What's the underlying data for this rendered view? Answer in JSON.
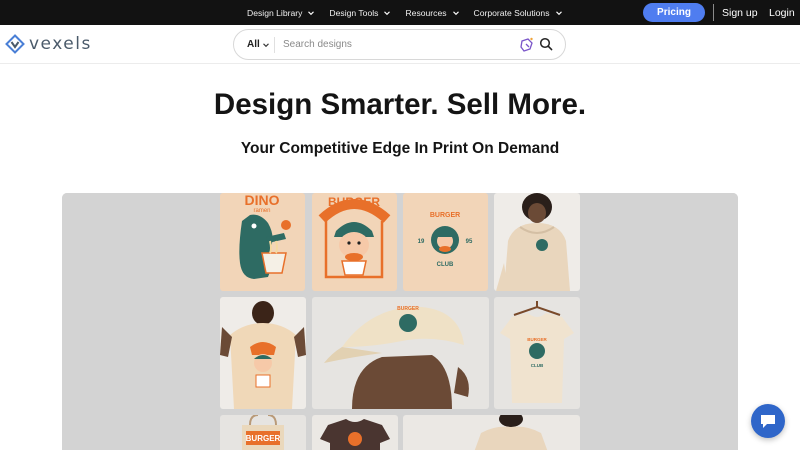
{
  "topnav": {
    "items": [
      {
        "label": "Design Library"
      },
      {
        "label": "Design Tools"
      },
      {
        "label": "Resources"
      },
      {
        "label": "Corporate Solutions"
      }
    ],
    "pricing_label": "Pricing",
    "signup_label": "Sign up",
    "login_label": "Login"
  },
  "header": {
    "logo_text": "vexels",
    "search": {
      "category": "All",
      "placeholder": "Search designs"
    }
  },
  "hero": {
    "title": "Design Smarter. Sell More.",
    "subtitle": "Your Competitive Edge In Print On Demand"
  },
  "showcase": {
    "graphic_texts": {
      "dino": "DINO",
      "dino_sub": "ramen",
      "burger": "BURGER",
      "club": "CLUB",
      "year_left": "19",
      "year_right": "95"
    }
  },
  "colors": {
    "topbar": "#121212",
    "pricing": "#4f7df0",
    "showcase_bg": "#d3d3d3",
    "accent_orange": "#e8702a",
    "accent_teal": "#2e6b63",
    "chat": "#2f66c9"
  },
  "icons": [
    "chevron-down-icon",
    "vexels-logo-icon",
    "ai-magic-icon",
    "search-icon",
    "chat-icon"
  ]
}
